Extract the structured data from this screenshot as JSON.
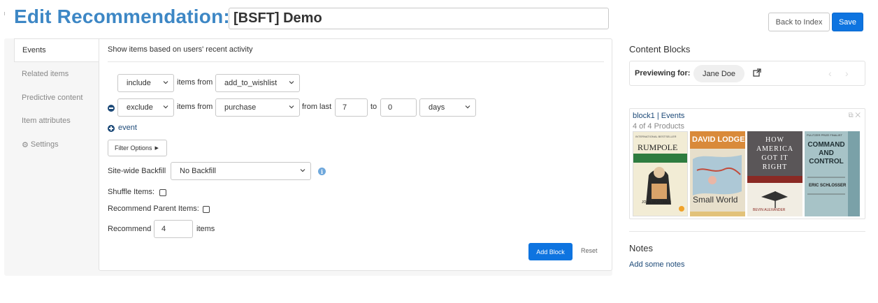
{
  "header": {
    "title": "Edit Recommendation:",
    "name_value": "[BSFT] Demo",
    "back_label": "Back to Index",
    "save_label": "Save"
  },
  "tabs": [
    {
      "label": "Events",
      "active": true
    },
    {
      "label": "Related items"
    },
    {
      "label": "Predictive content"
    },
    {
      "label": "Item attributes"
    },
    {
      "label": "Settings",
      "icon": "gear-icon"
    }
  ],
  "events": {
    "title": "Show items based on users' recent activity",
    "rows": [
      {
        "mode": "include",
        "items_from_label": "items from",
        "event": "add_to_wishlist"
      },
      {
        "mode": "exclude",
        "items_from_label": "items from",
        "event": "purchase",
        "from_last_label": "from last",
        "from_value": "7",
        "to_label": "to",
        "to_value": "0",
        "unit": "days"
      }
    ],
    "add_event_label": "event",
    "filter_options_label": "Filter Options",
    "backfill_label": "Site-wide Backfill",
    "backfill_value": "No Backfill",
    "shuffle_label": "Shuffle Items:",
    "parent_label": "Recommend Parent Items:",
    "recommend_label": "Recommend",
    "recommend_value": "4",
    "items_label": "items",
    "add_block_label": "Add Block",
    "reset_label": "Reset"
  },
  "content_blocks": {
    "title": "Content Blocks",
    "previewing_label": "Previewing for:",
    "preview_user": "Jane Doe",
    "block_title": "block1 | Events",
    "block_subtitle": "4 of 4 Products",
    "books": [
      {
        "top": "INTERNATIONAL BESTSELLER",
        "title": "RUMPOLE",
        "author": "JOHN MORTIMER"
      },
      {
        "title": "DAVID LODGE",
        "subtitle": "Small World"
      },
      {
        "title": "HOW AMERICA GOT IT RIGHT",
        "author": "BEVIN ALEXANDER"
      },
      {
        "top": "PULITZER PRIZE FINALIST",
        "title": "COMMAND AND CONTROL",
        "author": "ERIC SCHLOSSER"
      }
    ]
  },
  "notes": {
    "title": "Notes",
    "add_label": "Add some notes"
  }
}
